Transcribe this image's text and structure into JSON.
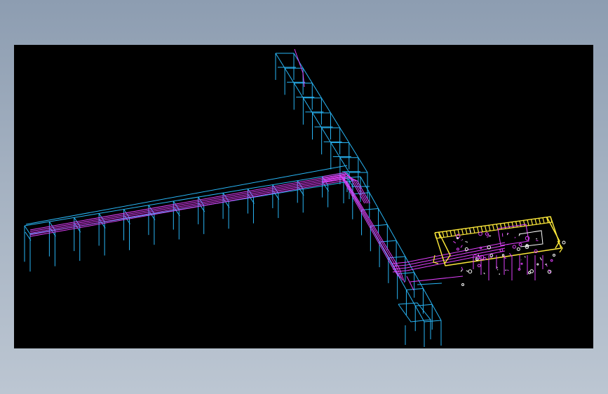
{
  "viewport": {
    "background": "#000000"
  },
  "colors": {
    "frame": "#29b6f6",
    "pipe": "#e040fb",
    "platform": "#ffeb3b",
    "equipment": "#ffffff"
  }
}
